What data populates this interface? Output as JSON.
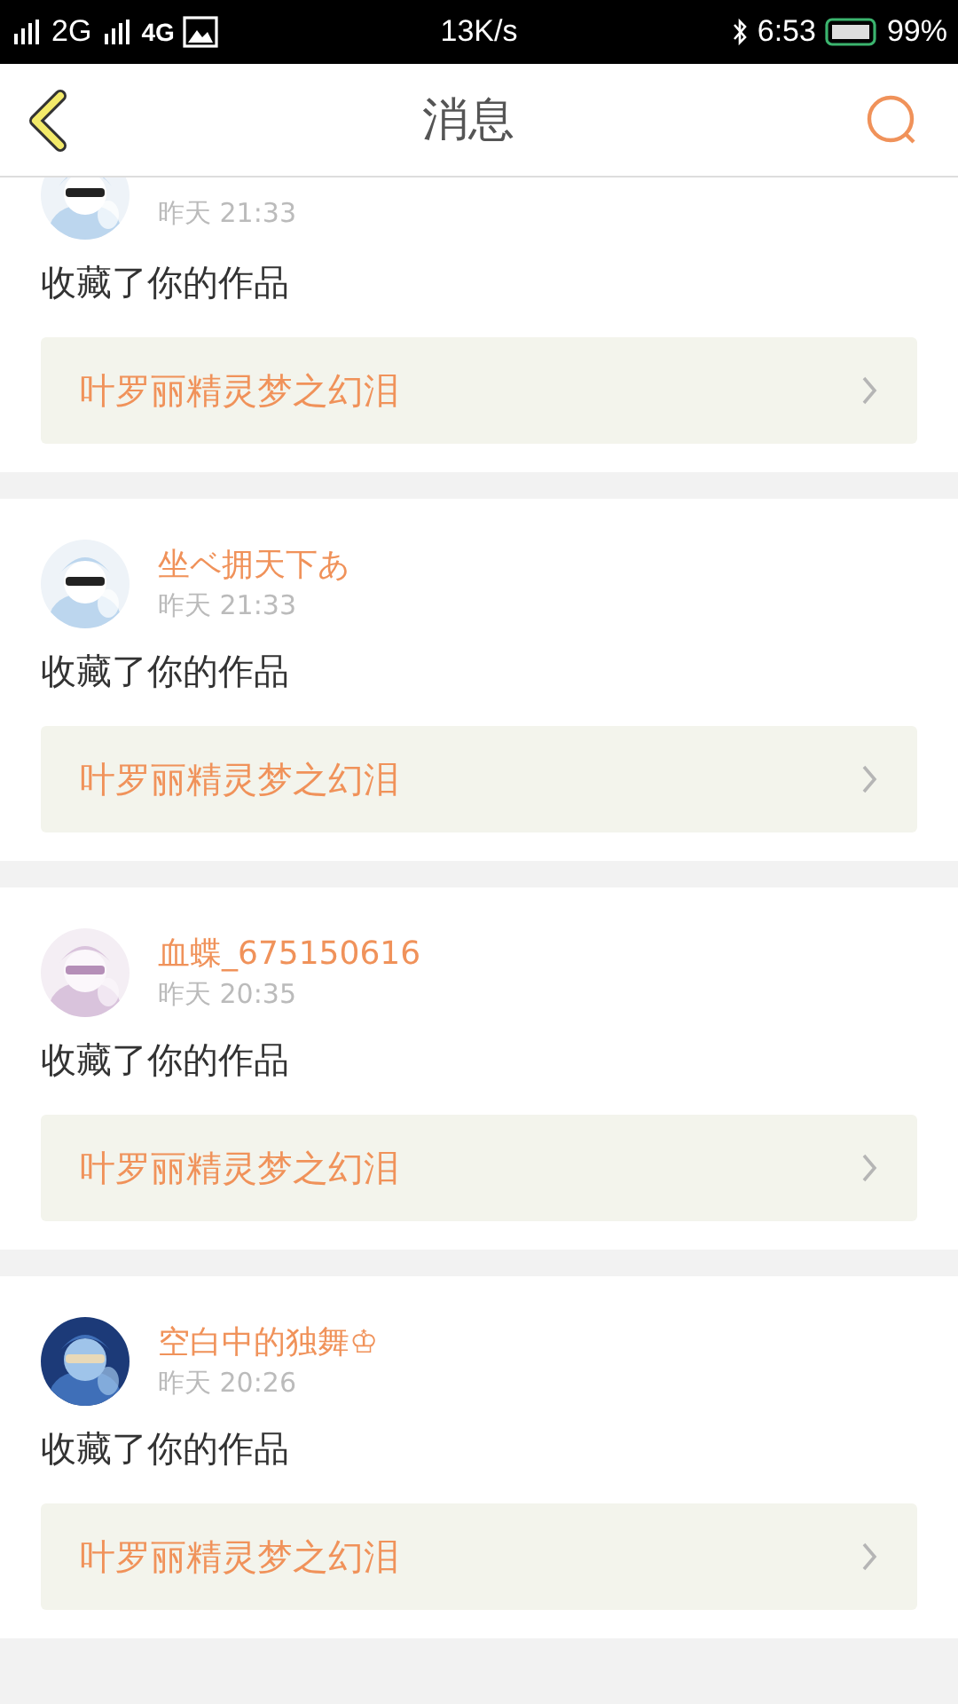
{
  "status_bar": {
    "network_1": "2G",
    "network_2": "4G",
    "speed": "13K/s",
    "time": "6:53",
    "battery": "99%"
  },
  "header": {
    "title": "消息"
  },
  "messages": [
    {
      "kind": "partial",
      "time": "昨天 21:33",
      "text": "收藏了你的作品",
      "work": "叶罗丽精灵梦之幻泪"
    },
    {
      "kind": "full",
      "name": "坐ベ拥天下あ",
      "time": "昨天 21:33",
      "text": "收藏了你的作品",
      "work": "叶罗丽精灵梦之幻泪"
    },
    {
      "kind": "full",
      "name": "血蝶_675150616",
      "time": "昨天 20:35",
      "text": "收藏了你的作品",
      "work": "叶罗丽精灵梦之幻泪"
    },
    {
      "kind": "full",
      "name": "空白中的独舞♔",
      "time": "昨天 20:26",
      "text": "收藏了你的作品",
      "work": "叶罗丽精灵梦之幻泪"
    }
  ]
}
